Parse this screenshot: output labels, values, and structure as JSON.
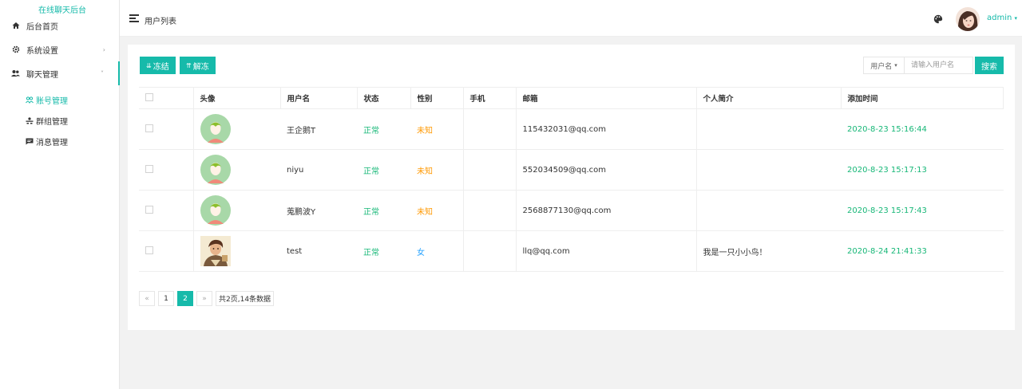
{
  "sidebar": {
    "logo": "在线聊天后台",
    "items": [
      {
        "label": "后台首页",
        "icon": "home-icon"
      },
      {
        "label": "系统设置",
        "icon": "gear-icon"
      },
      {
        "label": "聊天管理",
        "icon": "users-icon"
      }
    ],
    "sub_items": [
      {
        "label": "账号管理",
        "icon": "account-icon"
      },
      {
        "label": "群组管理",
        "icon": "group-icon"
      },
      {
        "label": "消息管理",
        "icon": "message-icon"
      }
    ]
  },
  "header": {
    "title": "用户列表",
    "username": "admin"
  },
  "toolbar": {
    "freeze_label": "冻结",
    "unfreeze_label": "解冻",
    "search_field_label": "用户名",
    "search_placeholder": "请输入用户名",
    "search_button": "搜索"
  },
  "table": {
    "columns": [
      "头像",
      "用户名",
      "状态",
      "性别",
      "手机",
      "邮箱",
      "个人简介",
      "添加时间"
    ],
    "rows": [
      {
        "username": "王企鹅T",
        "status": "正常",
        "gender": "未知",
        "phone": "",
        "email": "115432031@qq.com",
        "bio": "",
        "time": "2020-8-23 15:16:44"
      },
      {
        "username": "niyu",
        "status": "正常",
        "gender": "未知",
        "phone": "",
        "email": "552034509@qq.com",
        "bio": "",
        "time": "2020-8-23 15:17:13"
      },
      {
        "username": "蒐鹏波Y",
        "status": "正常",
        "gender": "未知",
        "phone": "",
        "email": "2568877130@qq.com",
        "bio": "",
        "time": "2020-8-23 15:17:43"
      },
      {
        "username": "test",
        "status": "正常",
        "gender": "女",
        "phone": "",
        "email": "llq@qq.com",
        "bio": "我是一只小小鸟！",
        "time": "2020-8-24 21:41:33"
      }
    ]
  },
  "pagination": {
    "prev": "«",
    "pages": [
      "1",
      "2"
    ],
    "current": "2",
    "next": "»",
    "summary": "共2页,14条数据"
  },
  "colors": {
    "accent": "#16baaa",
    "status_ok": "#16b777",
    "gender_unknown": "#ff9800",
    "gender_female": "#1e9fff"
  }
}
